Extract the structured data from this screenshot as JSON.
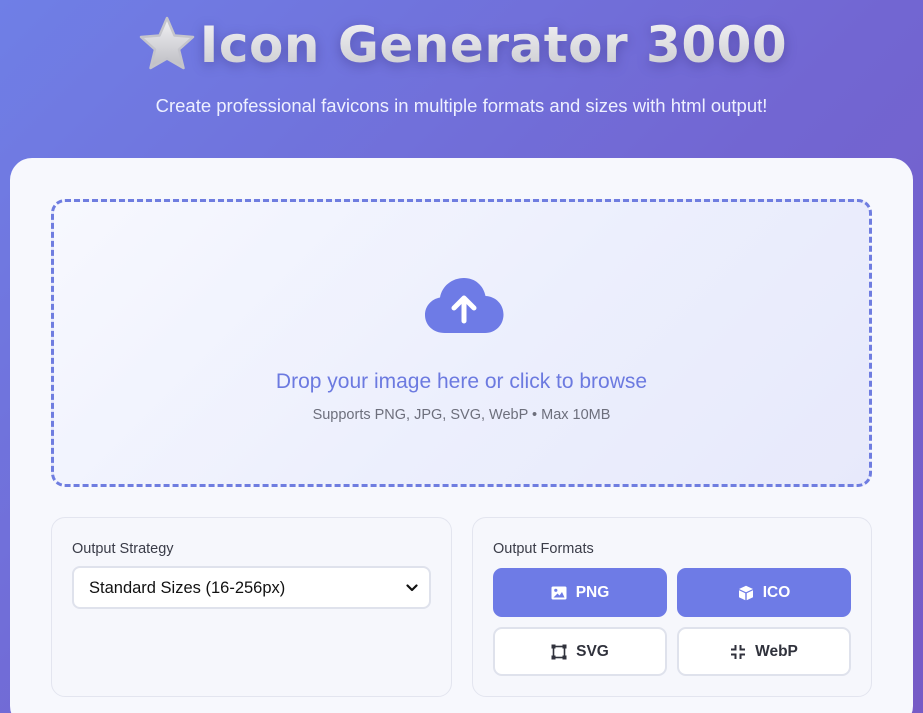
{
  "header": {
    "title": "Icon Generator 3000",
    "title_icon": "star-icon",
    "subtitle": "Create professional favicons in multiple formats and sizes with html output!"
  },
  "dropzone": {
    "icon": "cloud-upload-icon",
    "title": "Drop your image here or click to browse",
    "subtitle": "Supports PNG, JPG, SVG, WebP • Max 10MB"
  },
  "output_strategy": {
    "label": "Output Strategy",
    "selected": "Standard Sizes (16-256px)"
  },
  "output_formats": {
    "label": "Output Formats",
    "formats": [
      {
        "label": "PNG",
        "icon": "image-icon",
        "selected": true
      },
      {
        "label": "ICO",
        "icon": "cube-icon",
        "selected": true
      },
      {
        "label": "SVG",
        "icon": "vector-square-icon",
        "selected": false
      },
      {
        "label": "WebP",
        "icon": "compress-icon",
        "selected": false
      }
    ]
  },
  "colors": {
    "accent": "#6e7be6",
    "background_gradient_start": "#6f7fe6",
    "background_gradient_end": "#765bc6",
    "card_background": "#f7f8fd"
  }
}
